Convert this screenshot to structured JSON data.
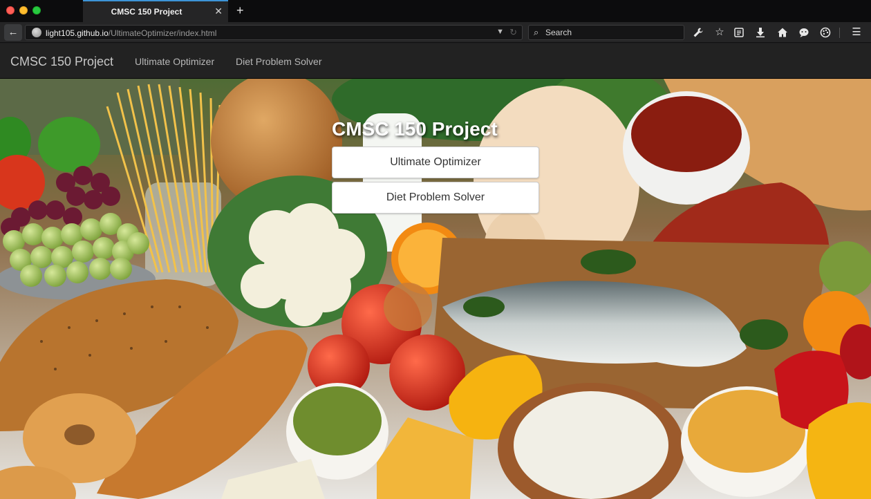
{
  "browser": {
    "tab_title": "CMSC 150 Project",
    "tab_close_glyph": "✕",
    "new_tab_glyph": "+",
    "url_domain": "light105.github.io",
    "url_path": "/UltimateOptimizer/index.html",
    "search_placeholder": "Search",
    "toolbar_icons": [
      "back-arrow-icon",
      "globe-icon",
      "dropdown-icon",
      "reload-icon",
      "search-icon",
      "wrench-icon",
      "bookmark-star-icon",
      "reader-list-icon",
      "download-icon",
      "home-icon",
      "chat-icon",
      "palette-icon",
      "menu-icon"
    ]
  },
  "site_nav": {
    "brand": "CMSC 150 Project",
    "links": [
      "Ultimate Optimizer",
      "Diet Problem Solver"
    ]
  },
  "hero": {
    "title": "CMSC 150 Project",
    "buttons": [
      "Ultimate Optimizer",
      "Diet Problem Solver"
    ],
    "background": "food photograph (bread, pasta, vegetables, fish, meat, fruit)"
  },
  "colors": {
    "tab_accent": "#3d94d8",
    "navbar_bg": "#222222",
    "button_bg": "#ffffff",
    "button_text": "#333333"
  }
}
